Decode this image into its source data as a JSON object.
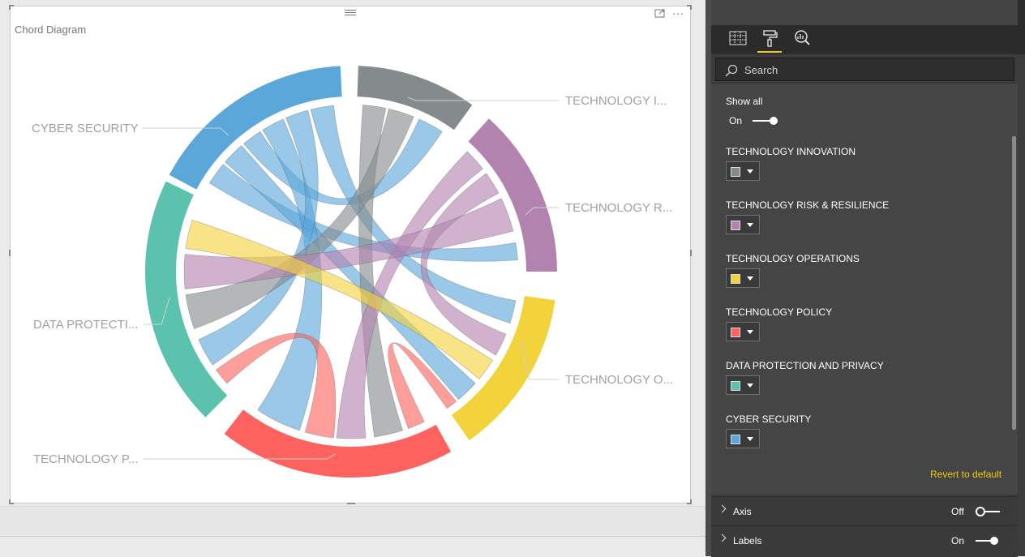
{
  "visual": {
    "title": "Chord Diagram",
    "focus_icon": "focus-mode-icon",
    "more_icon": "ellipsis-icon",
    "more_label": "···"
  },
  "chart_data": {
    "type": "chord",
    "title": "Chord Diagram",
    "groups": [
      {
        "name": "CYBER SECURITY",
        "label": "CYBER SECURITY",
        "color": "#5ba7da"
      },
      {
        "name": "TECHNOLOGY INNOVATION",
        "label": "TECHNOLOGY I...",
        "color": "#858b8d"
      },
      {
        "name": "TECHNOLOGY RISK & RESILIENCE",
        "label": "TECHNOLOGY R...",
        "color": "#b383b0"
      },
      {
        "name": "TECHNOLOGY OPERATIONS",
        "label": "TECHNOLOGY O...",
        "color": "#f3d33c"
      },
      {
        "name": "TECHNOLOGY POLICY",
        "label": "TECHNOLOGY P...",
        "color": "#fd625e"
      },
      {
        "name": "DATA PROTECTION AND PRIVACY",
        "label": "DATA PROTECTI...",
        "color": "#5bc2ad"
      }
    ]
  },
  "pane": {
    "tabs": [
      {
        "name": "fields-tab",
        "icon": "fields-grid-icon",
        "active": false
      },
      {
        "name": "format-tab",
        "icon": "paint-roller-icon",
        "active": true
      },
      {
        "name": "analytics-tab",
        "icon": "analytics-magnifier-icon",
        "active": false
      }
    ],
    "search_placeholder": "Search",
    "show_all": {
      "label": "Show all",
      "state": "On"
    },
    "colors": [
      {
        "label": "TECHNOLOGY INNOVATION",
        "color": "#858b8d"
      },
      {
        "label": "TECHNOLOGY RISK & RESILIENCE",
        "color": "#b383b0"
      },
      {
        "label": "TECHNOLOGY OPERATIONS",
        "color": "#f3d33c"
      },
      {
        "label": "TECHNOLOGY POLICY",
        "color": "#fd625e"
      },
      {
        "label": "DATA PROTECTION AND PRIVACY",
        "color": "#5bc2ad"
      },
      {
        "label": "CYBER SECURITY",
        "color": "#5ba7da"
      }
    ],
    "revert_label": "Revert to default",
    "sections": [
      {
        "title": "Axis",
        "state": "Off"
      },
      {
        "title": "Labels",
        "state": "On"
      }
    ]
  }
}
